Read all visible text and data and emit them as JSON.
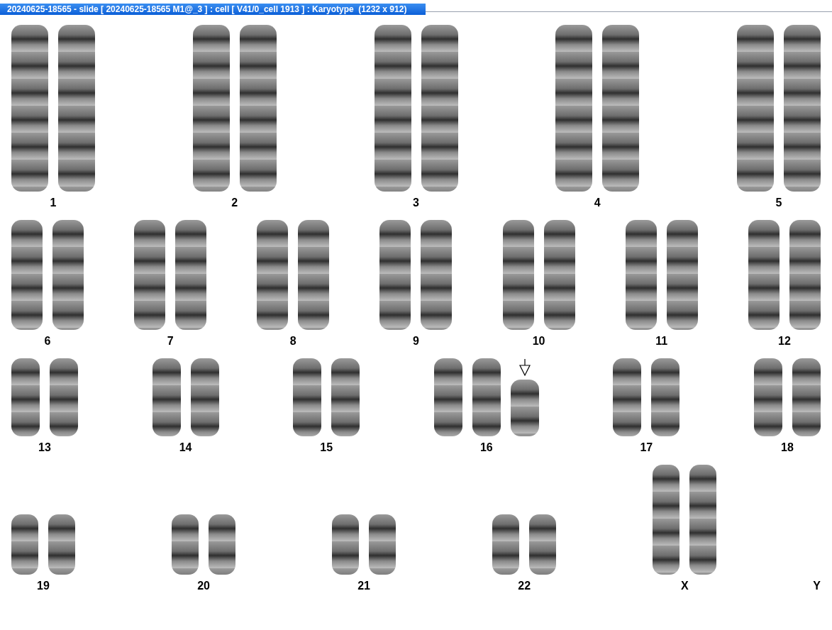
{
  "window": {
    "title": "20240625-18565 - slide [ 20240625-18565 M1@_3 ] : cell [ V41/0_cell 1913 ] : Karyotype  (1232 x 912)"
  },
  "rows": [
    {
      "kind": "large",
      "groups": [
        {
          "label": "1",
          "chromosomes": [
            {
              "arrow": false
            },
            {
              "arrow": false
            }
          ]
        },
        {
          "label": "2",
          "chromosomes": [
            {
              "arrow": false
            },
            {
              "arrow": false
            }
          ]
        },
        {
          "label": "3",
          "chromosomes": [
            {
              "arrow": false
            },
            {
              "arrow": false
            }
          ]
        },
        {
          "label": "4",
          "chromosomes": [
            {
              "arrow": false
            },
            {
              "arrow": false
            }
          ]
        },
        {
          "label": "5",
          "chromosomes": [
            {
              "arrow": false
            },
            {
              "arrow": false
            }
          ]
        }
      ]
    },
    {
      "kind": "medium",
      "groups": [
        {
          "label": "6",
          "chromosomes": [
            {
              "arrow": false
            },
            {
              "arrow": false
            }
          ]
        },
        {
          "label": "7",
          "chromosomes": [
            {
              "arrow": false
            },
            {
              "arrow": false
            }
          ]
        },
        {
          "label": "8",
          "chromosomes": [
            {
              "arrow": false
            },
            {
              "arrow": false
            }
          ]
        },
        {
          "label": "9",
          "chromosomes": [
            {
              "arrow": false
            },
            {
              "arrow": false
            }
          ]
        },
        {
          "label": "10",
          "chromosomes": [
            {
              "arrow": false
            },
            {
              "arrow": false
            }
          ]
        },
        {
          "label": "11",
          "chromosomes": [
            {
              "arrow": false
            },
            {
              "arrow": false
            }
          ]
        },
        {
          "label": "12",
          "chromosomes": [
            {
              "arrow": false
            },
            {
              "arrow": false
            }
          ]
        }
      ]
    },
    {
      "kind": "small",
      "groups": [
        {
          "label": "13",
          "chromosomes": [
            {
              "arrow": false
            },
            {
              "arrow": false
            }
          ]
        },
        {
          "label": "14",
          "chromosomes": [
            {
              "arrow": false
            },
            {
              "arrow": false
            }
          ]
        },
        {
          "label": "15",
          "chromosomes": [
            {
              "arrow": false
            },
            {
              "arrow": false
            }
          ]
        },
        {
          "label": "16",
          "chromosomes": [
            {
              "arrow": false
            },
            {
              "arrow": false
            },
            {
              "arrow": true
            }
          ]
        },
        {
          "label": "17",
          "chromosomes": [
            {
              "arrow": false
            },
            {
              "arrow": false
            }
          ]
        },
        {
          "label": "18",
          "chromosomes": [
            {
              "arrow": false
            },
            {
              "arrow": false
            }
          ]
        }
      ]
    },
    {
      "kind": "tiny",
      "groups": [
        {
          "label": "19",
          "chromosomes": [
            {
              "arrow": false
            },
            {
              "arrow": false
            }
          ]
        },
        {
          "label": "20",
          "chromosomes": [
            {
              "arrow": false
            },
            {
              "arrow": false
            }
          ]
        },
        {
          "label": "21",
          "chromosomes": [
            {
              "arrow": false
            },
            {
              "arrow": false
            }
          ]
        },
        {
          "label": "22",
          "chromosomes": [
            {
              "arrow": false
            },
            {
              "arrow": false
            }
          ]
        },
        {
          "label": "X",
          "chromosomes": [
            {
              "arrow": false
            },
            {
              "arrow": false
            }
          ]
        },
        {
          "label": "Y"
        }
      ]
    }
  ]
}
